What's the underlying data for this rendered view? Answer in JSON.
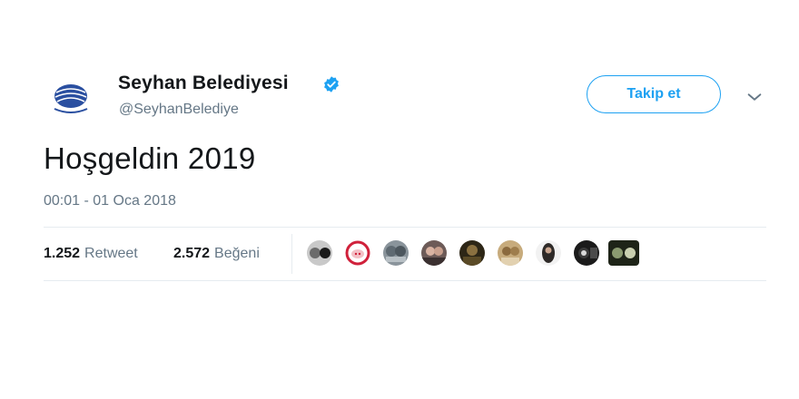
{
  "account": {
    "display_name": "Seyhan Belediyesi",
    "handle": "@SeyhanBelediye",
    "verified": true,
    "avatar_icon": "seyhan-municipality-logo"
  },
  "actions": {
    "follow_label": "Takip et",
    "menu_icon": "chevron-down-icon"
  },
  "tweet": {
    "text": "Hoşgeldin 2019",
    "timestamp": "00:01 - 01 Oca 2018"
  },
  "stats": {
    "retweet_count": "1.252",
    "retweet_label": "Retweet",
    "like_count": "2.572",
    "like_label": "Beğeni"
  },
  "likers": [
    {
      "icon": "liker-avatar-1",
      "color": "#9a9a9a"
    },
    {
      "icon": "liker-avatar-2",
      "color": "#d0213b"
    },
    {
      "icon": "liker-avatar-3",
      "color": "#6f7c86"
    },
    {
      "icon": "liker-avatar-4",
      "color": "#5b4a48"
    },
    {
      "icon": "liker-avatar-5",
      "color": "#3d3320"
    },
    {
      "icon": "liker-avatar-6",
      "color": "#a58a5c"
    },
    {
      "icon": "liker-avatar-7",
      "color": "#2e2a28"
    },
    {
      "icon": "liker-avatar-8",
      "color": "#1b1b1b"
    },
    {
      "icon": "liker-avatar-9",
      "color": "#2f3a28"
    }
  ],
  "colors": {
    "accent": "#1da1f2",
    "text_primary": "#14171a",
    "text_secondary": "#657786",
    "divider": "#e6ecf0"
  }
}
